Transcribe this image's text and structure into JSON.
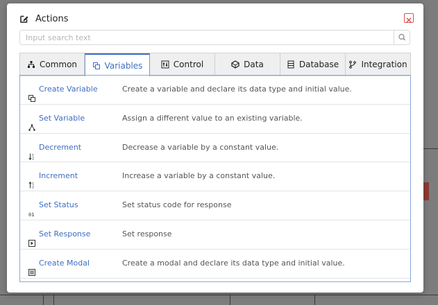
{
  "modal": {
    "title": "Actions",
    "icons": {
      "title": "edit-icon",
      "close": "close-icon",
      "search": "search-icon"
    }
  },
  "search": {
    "placeholder": "Input search text",
    "value": ""
  },
  "tabs": [
    {
      "label": "Common",
      "icon": "sitemap-icon",
      "active": false
    },
    {
      "label": "Variables",
      "icon": "copy-icon",
      "active": true
    },
    {
      "label": "Control",
      "icon": "control-icon",
      "active": false
    },
    {
      "label": "Data",
      "icon": "cube-icon",
      "active": false
    },
    {
      "label": "Database",
      "icon": "database-icon",
      "active": false
    },
    {
      "label": "Integration",
      "icon": "git-branch-icon",
      "active": false
    }
  ],
  "actions": [
    {
      "name": "Create Variable",
      "icon": "copy-icon",
      "description": "Create a variable and declare its data type and initial value."
    },
    {
      "name": "Set Variable",
      "icon": "sitemap-icon",
      "description": "Assign a different value to an existing variable."
    },
    {
      "name": "Decrement",
      "icon": "sort-desc-icon",
      "description": "Decrease a variable by a constant value."
    },
    {
      "name": "Increment",
      "icon": "sort-asc-icon",
      "description": "Increase a variable by a constant value."
    },
    {
      "name": "Set Status",
      "icon": "binary-icon",
      "description": "Set status code for response"
    },
    {
      "name": "Set Response",
      "icon": "play-square-icon",
      "description": "Set response"
    },
    {
      "name": "Create Modal",
      "icon": "list-icon",
      "description": "Create a modal and declare its data type and initial value."
    }
  ],
  "colors": {
    "accent": "#3f6ec2",
    "close": "#e05050",
    "overlay": "#7d7d7d"
  }
}
